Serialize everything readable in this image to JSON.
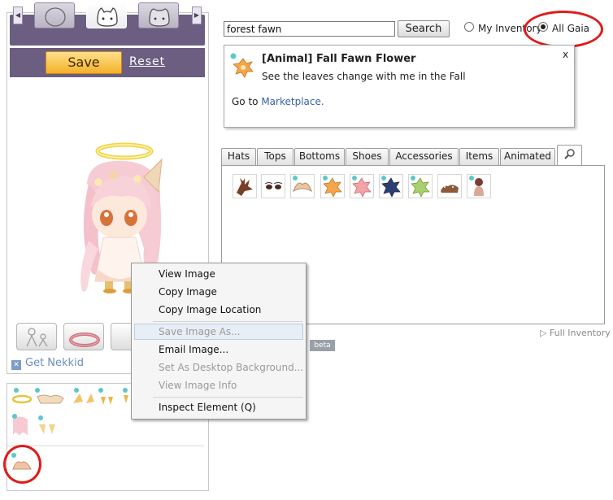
{
  "editor": {
    "save_label": "Save",
    "reset_label": "Reset",
    "get_nekkid_label": "Get Nekkid"
  },
  "search": {
    "query": "forest fawn",
    "button_label": "Search",
    "scope_options": [
      {
        "label": "My Inventory",
        "checked": false
      },
      {
        "label": "All Gaia",
        "checked": true
      }
    ]
  },
  "item_info": {
    "title": "[Animal] Fall Fawn Flower",
    "description": "See the leaves change with me in the Fall",
    "goto_prefix": "Go to ",
    "goto_link": "Marketplace.",
    "close_label": "x"
  },
  "tabs": [
    "Hats",
    "Tops",
    "Bottoms",
    "Shoes",
    "Accessories",
    "Items",
    "Animated"
  ],
  "full_inventory_label": "Full Inventory",
  "beta_label": "beta",
  "context_menu": {
    "items": [
      {
        "label": "View Image",
        "enabled": true
      },
      {
        "label": "Copy Image",
        "enabled": true
      },
      {
        "label": "Copy Image Location",
        "enabled": true
      },
      {
        "label": "Save Image As...",
        "enabled": false,
        "highlighted": true
      },
      {
        "label": "Email Image...",
        "enabled": true
      },
      {
        "label": "Set As Desktop Background...",
        "enabled": false
      },
      {
        "label": "View Image Info",
        "enabled": false
      },
      {
        "label": "Inspect Element (Q)",
        "enabled": true
      }
    ]
  },
  "colors": {
    "panel_purple": "#6b5e80",
    "save_orange": "#f4b12a",
    "link_blue": "#3c5ea8",
    "annotation_red": "#e01b1b"
  }
}
